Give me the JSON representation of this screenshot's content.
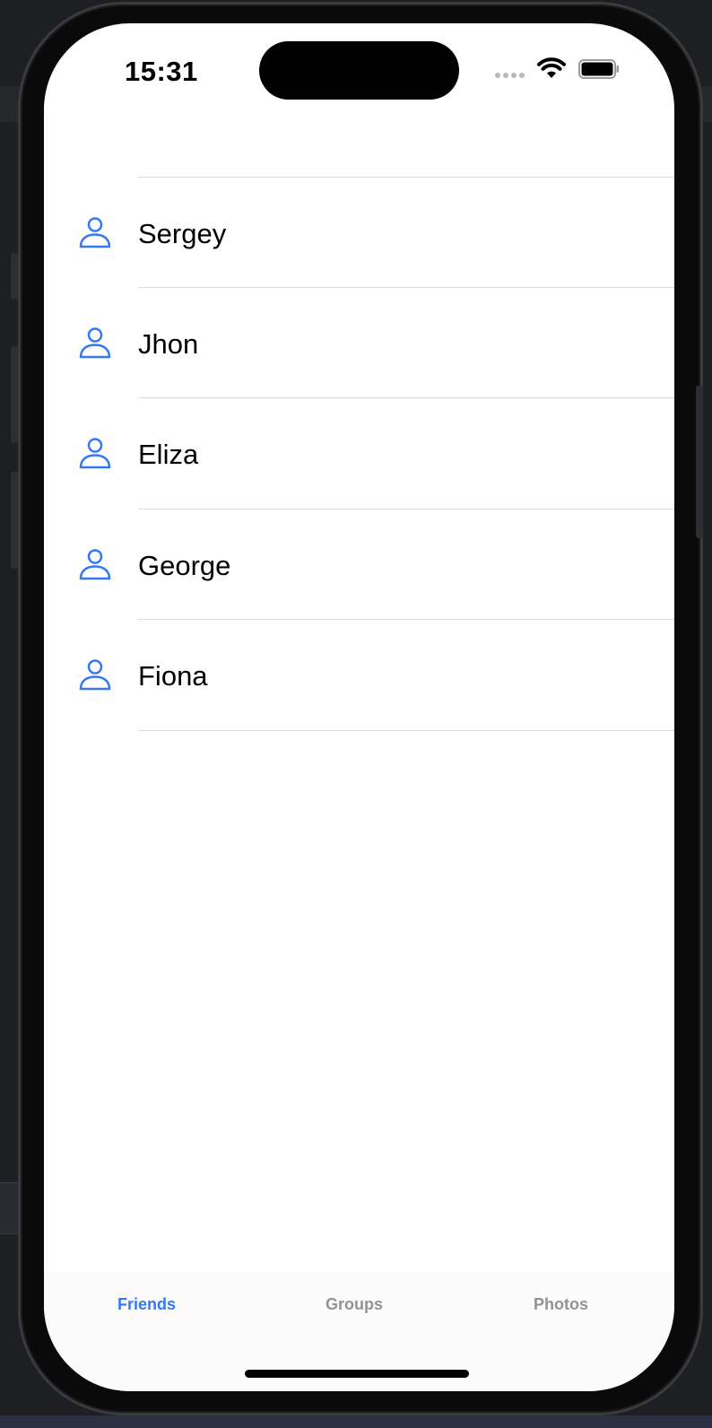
{
  "status_bar": {
    "time": "15:31"
  },
  "friends": [
    {
      "name": "Sergey",
      "icon": "person-icon"
    },
    {
      "name": "Jhon",
      "icon": "person-icon"
    },
    {
      "name": "Eliza",
      "icon": "person-icon"
    },
    {
      "name": "George",
      "icon": "person-icon"
    },
    {
      "name": "Fiona",
      "icon": "person-icon"
    }
  ],
  "tab_bar": {
    "tabs": [
      {
        "label": "Friends",
        "active": true
      },
      {
        "label": "Groups",
        "active": false
      },
      {
        "label": "Photos",
        "active": false
      }
    ]
  },
  "colors": {
    "accent": "#3478f6",
    "inactive_tab": "#939396",
    "separator": "#dcdcdf"
  }
}
